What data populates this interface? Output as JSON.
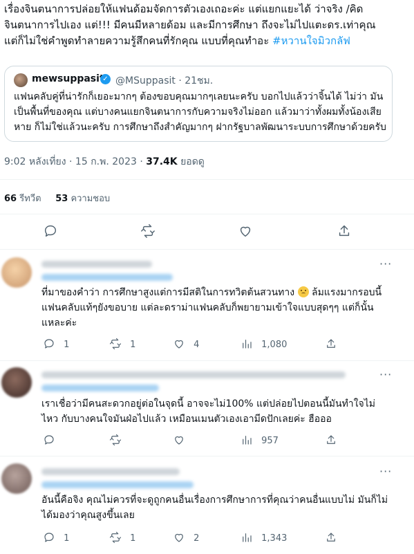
{
  "tweet": {
    "text": "เรื่องจินตนาการปล่อยให้แฟนด้อมจัดการตัวเองเถอะค่ะ แต่แยกแยะได้ ว่าจริง /คิดจินตนาการไปเอง แต่!!! มีคนมีหลายด้อม และมีการศึกษา ถึงจะไม่ไปแตะดร.เท่าคุณ แต่ก็ไม่ใช่คำพูดทำลายความรู้สึกคนที่รักคุณ แบบที่คุณทำอะ",
    "hashtag": "#หวานใจมิวกลัฟ",
    "time": "9:02 หลังเที่ยง · 15 ก.พ. 2023 ·",
    "views_count": "37.4K",
    "views_label": "ยอดดู",
    "retweets_count": "66",
    "retweets_label": "รีทวีต",
    "likes_count": "53",
    "likes_label": "ความชอบ"
  },
  "quote": {
    "name": "mewsuppasit",
    "handle": "@MSuppasit · 21ชม.",
    "text": "แฟนคลับคู่ที่น่ารักก็เยอะมากๆ ต้องขอบคุณมากๆเลยนะครับ บอกไปแล้วว่าจิ้นได้ ไม่ว่า มันเป็นพื้นที่ของคุณ แต่บางคนแยกจินตนาการกับความจริงไม่ออก แล้วมาว่าทั้งผมทั้งน้องเสียหาย ก็ไม่ใช่แล้วนะครับ การศึกษาถึงสำคัญมากๆ ฝากรัฐบาลพัฒนาระบบการศึกษาด้วยครับ"
  },
  "replies": [
    {
      "text_a": "ที่มาของคำว่า การศึกษาสูงแต่การมีสติในการทวิตต้นสวนทาง",
      "text_b": "ล้มแรงมากรอบนี้ แฟนคลับแท้ๆยังขอบาย แต่ละดราม่าแฟนคลับก็พยายามเข้าใจแบบสุดๆๆ แต่ก็นั้นแหละค่ะ",
      "replies": "1",
      "retweets": "1",
      "likes": "4",
      "views": "1,080"
    },
    {
      "text": "เราเชื่อว่ามีคนสะดวกอยู่ต่อในจุดนี้ อาจจะไม่100% แต่ปล่อยไปตอนนี้มันทำใจไม่ไหว กับบางคนใจมันฝ่อไปแล้ว เหมือนเมนตัวเองเอามีดปักเลยค่ะ ฮือออ",
      "views": "957"
    },
    {
      "text": "อันนี้คือจิง คุณไม่ควรที่จะดูถูกคนอื่นเรื่องการศึกษาการที่คุณว่าคนอื่นแบบไม่ มันก็ไม่ได้มองว่าคุณสูงขึ้นเลย",
      "replies": "1",
      "retweets": "1",
      "likes": "2",
      "views": "1,343"
    }
  ],
  "colors": {
    "accent": "#1d9bf0",
    "muted": "#536471",
    "text": "#0f1419",
    "border": "#cfd9de"
  },
  "icons": [
    "reply-icon",
    "retweet-icon",
    "like-icon",
    "share-icon",
    "views-icon",
    "more-icon",
    "verified-icon"
  ]
}
